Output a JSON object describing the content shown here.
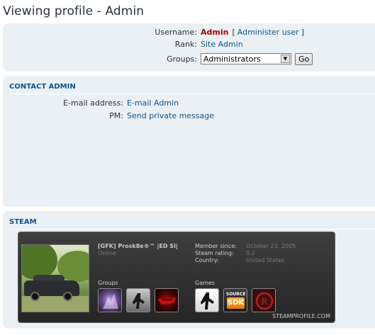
{
  "page": {
    "title": "Viewing profile - Admin"
  },
  "profile": {
    "username_label": "Username:",
    "username_value": "Admin",
    "administer_open": "[",
    "administer_link": "Administer user",
    "administer_close": "]",
    "rank_label": "Rank:",
    "rank_value": "Site Admin",
    "groups_label": "Groups:",
    "groups_selected": "Administrators",
    "go_label": "Go"
  },
  "contact": {
    "heading": "CONTACT ADMIN",
    "email_label": "E-mail address:",
    "email_link": "E-mail Admin",
    "pm_label": "PM:",
    "pm_link": "Send private message"
  },
  "steam": {
    "heading": "STEAM",
    "card": {
      "player_name": "[GFK] Prosk8e®™ |ED SI|",
      "status": "Online",
      "member_since_label": "Member since:",
      "member_since_value": "October 23, 2005",
      "steam_rating_label": "Steam rating:",
      "steam_rating_value": "0.2",
      "country_label": "Country:",
      "country_value": "United States",
      "groups_label": "Groups",
      "games_label": "Games",
      "sdk_source": "SOURCE",
      "sdk_text": "SDK",
      "footer": "STEAMPROFILE.COM"
    }
  },
  "colors": {
    "panel_bg": "#eaf0f4",
    "link": "#105289",
    "username": "#aa0000",
    "text": "#28313f",
    "card_bg": "#2e2e2e"
  },
  "icons": {
    "select_arrow": "chevron-down-icon",
    "group_1": "group-purple-creature-icon",
    "group_2": "group-counter-strike-icon",
    "group_3": "group-red-logo-icon",
    "game_1": "counter-strike-icon",
    "game_2": "source-sdk-icon",
    "game_3": "red-r-logo-icon"
  }
}
